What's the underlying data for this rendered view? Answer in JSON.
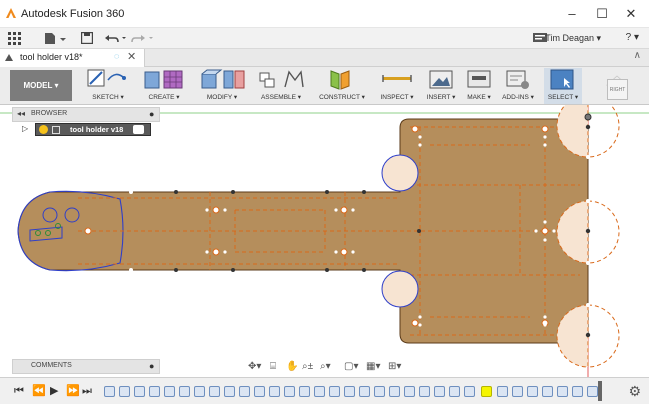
{
  "title": "Autodesk Fusion 360",
  "window_controls": {
    "minimize": "–",
    "maximize": "☐",
    "close": "✕"
  },
  "toolbar": {
    "user_name": "Tim Deagan ▾",
    "help": "? ▾"
  },
  "document_tab": {
    "name": "tool holder v18*",
    "close": "✕"
  },
  "ribbon": {
    "workspace": "MODEL ▾",
    "groups": [
      {
        "label": "SKETCH ▾"
      },
      {
        "label": "CREATE ▾"
      },
      {
        "label": "MODIFY ▾"
      },
      {
        "label": "ASSEMBLE ▾"
      },
      {
        "label": "CONSTRUCT ▾"
      },
      {
        "label": "INSPECT ▾"
      },
      {
        "label": "INSERT ▾"
      },
      {
        "label": "MAKE ▾"
      },
      {
        "label": "ADD-INS ▾"
      },
      {
        "label": "SELECT ▾"
      }
    ]
  },
  "browser": {
    "title": "BROWSER",
    "root_label": "tool holder v18"
  },
  "comments": {
    "title": "COMMENTS"
  },
  "viewcube": {
    "face": "RIGHT"
  },
  "colors": {
    "part_fill": "#b58e5c",
    "part_edge": "#5a3a18",
    "sketch_line": "#d9691a",
    "profile_fill": "#f7e4d2",
    "circle_edge": "#2f3fc9",
    "selected_feature": "#f5f500",
    "accent": "#2aa3d8"
  },
  "icons": {
    "app": "fusion-logo-icon",
    "grid": "data-panel-icon",
    "file": "file-icon",
    "save": "save-icon",
    "undo": "undo-icon",
    "redo": "redo-icon",
    "notifications": "notifications-icon"
  }
}
